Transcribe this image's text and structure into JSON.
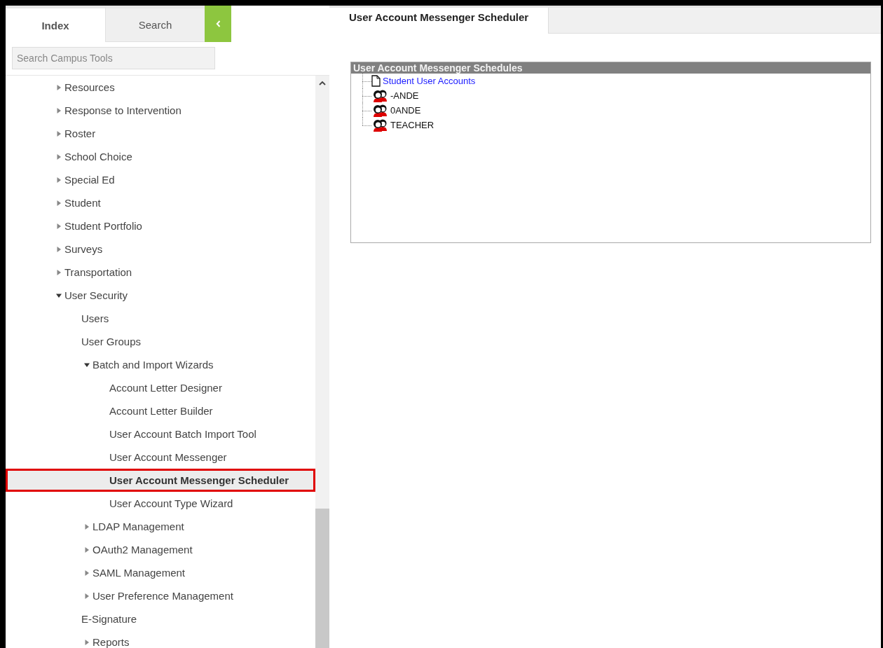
{
  "sidebar": {
    "tabs": [
      {
        "label": "Index",
        "selected": true
      },
      {
        "label": "Search",
        "selected": false
      }
    ],
    "search": {
      "placeholder": "Search Campus Tools"
    },
    "tree": [
      {
        "kind": "folder",
        "label": "Resources",
        "expanded": false
      },
      {
        "kind": "folder",
        "label": "Response to Intervention",
        "expanded": false
      },
      {
        "kind": "folder",
        "label": "Roster",
        "expanded": false
      },
      {
        "kind": "folder",
        "label": "School Choice",
        "expanded": false
      },
      {
        "kind": "folder",
        "label": "Special Ed",
        "expanded": false
      },
      {
        "kind": "folder",
        "label": "Student",
        "expanded": false
      },
      {
        "kind": "folder",
        "label": "Student Portfolio",
        "expanded": false
      },
      {
        "kind": "folder",
        "label": "Surveys",
        "expanded": false
      },
      {
        "kind": "folder",
        "label": "Transportation",
        "expanded": false
      },
      {
        "kind": "folder",
        "label": "User Security",
        "expanded": true,
        "children": [
          {
            "kind": "tool",
            "label": "Users",
            "selected": false
          },
          {
            "kind": "tool",
            "label": "User Groups",
            "selected": false
          },
          {
            "kind": "folder",
            "label": "Batch and Import Wizards",
            "expanded": true,
            "children": [
              {
                "kind": "tool",
                "label": "Account Letter Designer",
                "selected": false
              },
              {
                "kind": "tool",
                "label": "Account Letter Builder",
                "selected": false
              },
              {
                "kind": "tool",
                "label": "User Account Batch Import Tool",
                "selected": false
              },
              {
                "kind": "tool",
                "label": "User Account Messenger",
                "selected": false
              },
              {
                "kind": "tool",
                "label": "User Account Messenger Scheduler",
                "selected": true
              },
              {
                "kind": "tool",
                "label": "User Account Type Wizard",
                "selected": false
              }
            ]
          },
          {
            "kind": "folder",
            "label": "LDAP Management",
            "expanded": false
          },
          {
            "kind": "folder",
            "label": "OAuth2 Management",
            "expanded": false
          },
          {
            "kind": "folder",
            "label": "SAML Management",
            "expanded": false
          },
          {
            "kind": "folder",
            "label": "User Preference Management",
            "expanded": false
          },
          {
            "kind": "tool",
            "label": "E-Signature",
            "selected": false
          },
          {
            "kind": "folder",
            "label": "Reports",
            "expanded": false
          }
        ]
      }
    ]
  },
  "main": {
    "tabs": [
      {
        "label": "User Account Messenger Scheduler",
        "selected": true
      }
    ],
    "panel": {
      "title": "User Account Messenger Schedules",
      "items": [
        {
          "kind": "document",
          "label": "Student User Accounts"
        },
        {
          "kind": "group",
          "label": "-ANDE"
        },
        {
          "kind": "group",
          "label": "0ANDE"
        },
        {
          "kind": "group",
          "label": "TEACHER"
        }
      ]
    }
  }
}
